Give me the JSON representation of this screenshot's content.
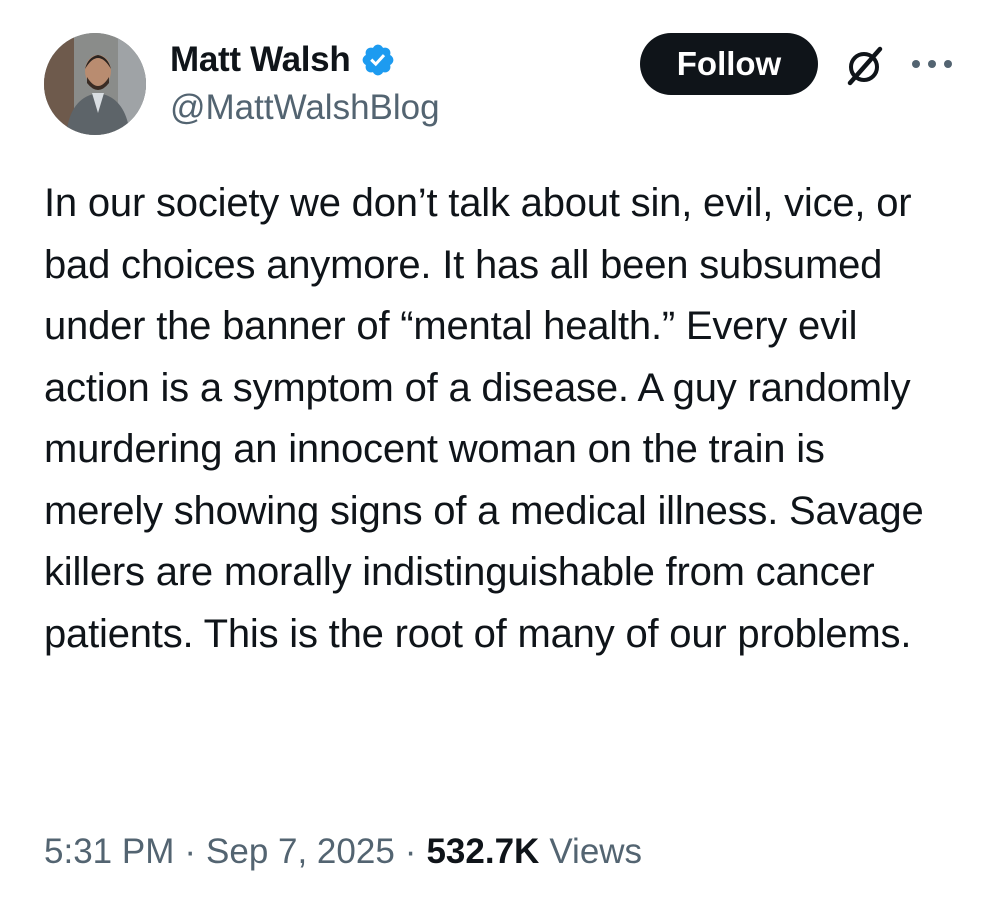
{
  "author": {
    "display_name": "Matt Walsh",
    "handle": "@MattWalshBlog",
    "verified": true
  },
  "actions": {
    "follow_label": "Follow",
    "grok_icon": "grok-icon",
    "more_icon": "more-icon"
  },
  "post": {
    "text": "In our society we don’t talk about sin, evil, vice, or bad choices anymore. It has all been subsumed under the banner of “mental health.” Every evil action is a symptom of a disease. A guy randomly murdering an innocent woman on the train is merely showing signs of a medical illness. Savage killers are morally indistinguishable from cancer patients. This is the root of many of our problems.",
    "time": "5:31 PM",
    "date": "Sep 7, 2025",
    "separator": "·",
    "views_count": "532.7K",
    "views_label": "Views"
  },
  "colors": {
    "text_primary": "#0f1419",
    "text_secondary": "#536471",
    "verified_blue": "#1d9bf0",
    "button_bg": "#0f1419"
  }
}
